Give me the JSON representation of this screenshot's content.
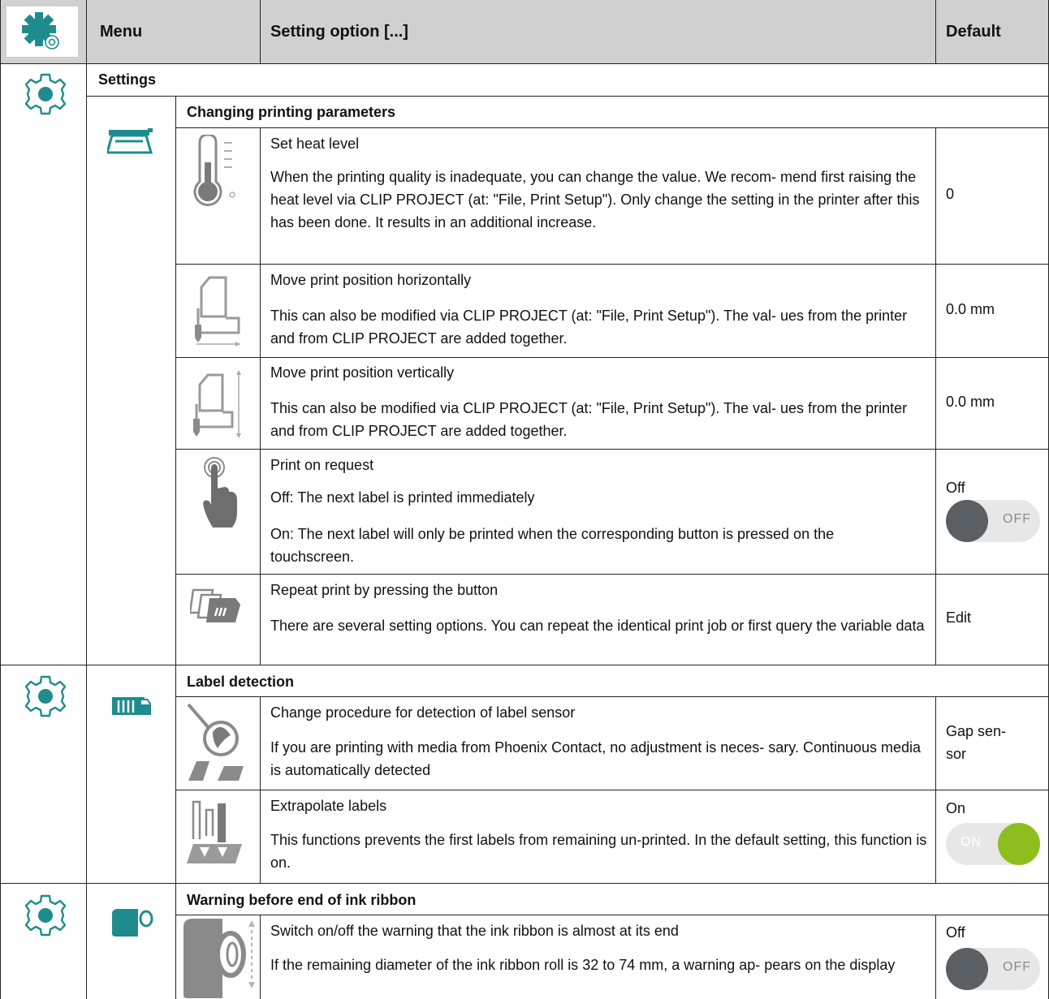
{
  "header": {
    "menu": "Menu",
    "setting_option": "Setting option  [...]",
    "default": "Default"
  },
  "sections": {
    "settings": "Settings",
    "printing_params": "Changing printing parameters",
    "label_detection": "Label detection",
    "ink_warning": "Warning before end of ink ribbon"
  },
  "rows": {
    "heat": {
      "title": "Set heat level",
      "desc": "When the printing quality is inadequate, you can change the value. We recom- mend first raising the heat level via CLIP PROJECT (at: \"File, Print Setup\"). Only change the setting in the printer after this has been done. It results in an additional increase.",
      "default": "0"
    },
    "horiz": {
      "title": "Move print position horizontally",
      "desc": "This can also be modified via CLIP PROJECT (at: \"File, Print Setup\"). The val- ues from the printer and from CLIP PROJECT are added together.",
      "default": "0.0 mm"
    },
    "vert": {
      "title": "Move print position vertically",
      "desc": "This can also be modified via CLIP PROJECT (at: \"File, Print Setup\"). The val- ues from the printer and from CLIP PROJECT are added together.",
      "default": "0.0 mm"
    },
    "request": {
      "title": "Print on request",
      "desc_off": "Off: The next label is printed immediately",
      "desc_on": "On: The next label will only be printed when the corresponding button is pressed on the touchscreen.",
      "default": "Off",
      "toggle_text": "OFF"
    },
    "repeat": {
      "title": "Repeat print by pressing the button",
      "desc": "There are several setting options. You can repeat the identical print job or first query the variable data",
      "default": "Edit"
    },
    "sensor": {
      "title": "Change procedure for detection of label sensor",
      "desc": "If you are printing with media from Phoenix Contact, no adjustment is neces- sary. Continuous media is automatically detected",
      "default_line1": "Gap sen-",
      "default_line2": "sor"
    },
    "extrapolate": {
      "title": "Extrapolate labels",
      "desc": "This functions prevents the first labels from remaining un-printed. In the default setting, this function is on.",
      "default": "On",
      "toggle_text": "ON"
    },
    "ribbon": {
      "title": "Switch on/off the warning that the ink ribbon is almost at its end",
      "desc": "If the remaining diameter of the ink ribbon roll is 32 to 74 mm, a warning ap- pears on the display",
      "default": "Off",
      "toggle_text": "OFF"
    }
  },
  "colors": {
    "accent_teal": "#1e8c8c",
    "header_gray": "#d0d0d0",
    "toggle_on": "#8cbf1e",
    "toggle_off": "#5a5f63",
    "icon_gray": "#8a8a8a"
  },
  "icons": [
    "settings-gear-icon",
    "gear-icon",
    "printer-icon",
    "thermometer-icon",
    "horizontal-position-icon",
    "vertical-position-icon",
    "touch-finger-icon",
    "repeat-labels-icon",
    "label-roll-icon",
    "sensor-icon",
    "extrapolate-icon",
    "ribbon-icon",
    "ribbon-diameter-icon"
  ]
}
